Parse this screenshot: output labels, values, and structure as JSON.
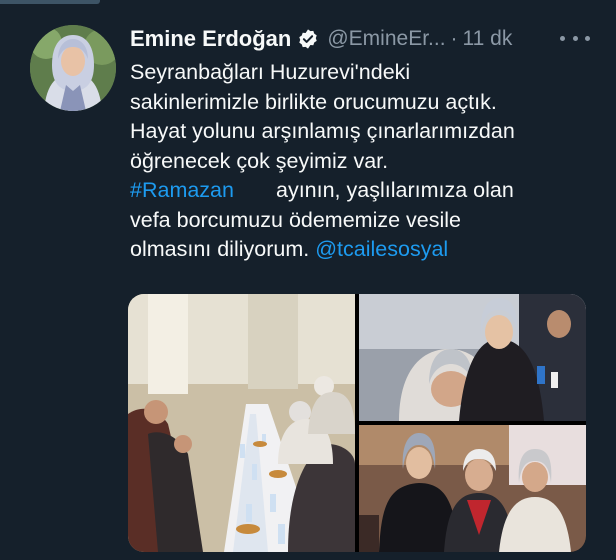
{
  "tweet": {
    "display_name": "Emine Erdoğan",
    "handle": "@EmineEr...",
    "separator": "·",
    "time": "11 dk",
    "text_lines": [
      "Seyranbağları Huzurevi'ndeki",
      "sakinlerimizle birlikte orucumuzu açtık.",
      "Hayat yolunu arşınlamış çınarlarımızdan",
      "öğrenecek çok şeyimiz var."
    ],
    "hashtag": "#Ramazan",
    "line5_rest": "ayının, yaşlılarımıza olan",
    "line6": "vefa borcumuzu ödememize vesile",
    "line7": "olmasını diliyorum.",
    "mention": "@tcailesosyal"
  },
  "icons": {
    "verified": "verified-badge-icon",
    "more": "more-horizontal-icon"
  },
  "colors": {
    "background": "#15202b",
    "text": "#f7f9f9",
    "secondary_text": "#8b98a5",
    "link": "#1d9bf0"
  }
}
